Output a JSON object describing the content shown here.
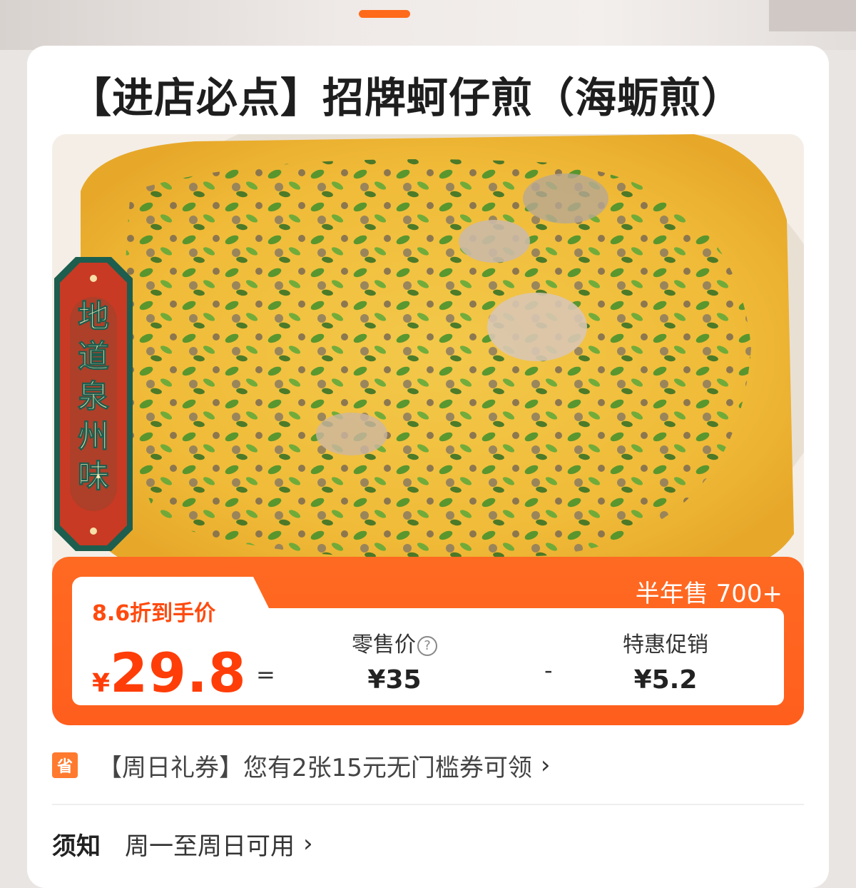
{
  "header": {
    "tab_indicator": "active"
  },
  "product": {
    "title": "【进店必点】招牌蚵仔煎（海蛎煎）",
    "badge_chars": [
      "地",
      "道",
      "泉",
      "州",
      "味"
    ]
  },
  "price": {
    "sold_label": "半年售 700+",
    "discount_label": "8.6折到手价",
    "currency": "¥",
    "final_value": "29.8",
    "equals": "=",
    "minus": "-",
    "retail_label": "零售价",
    "retail_help_icon": "question-circle-icon",
    "retail_value": "¥35",
    "promo_label": "特惠促销",
    "promo_value": "¥5.2"
  },
  "coupon": {
    "icon_text": "省",
    "text": "【周日礼券】您有2张15元无门槛券可领",
    "chevron": "chevron-right-icon"
  },
  "notice": {
    "label": "须知",
    "text": "周一至周日可用",
    "chevron": "chevron-right-icon"
  },
  "colors": {
    "accent": "#ff5e1d",
    "badge_red": "#c83a23",
    "badge_green": "#1d5e4f"
  }
}
